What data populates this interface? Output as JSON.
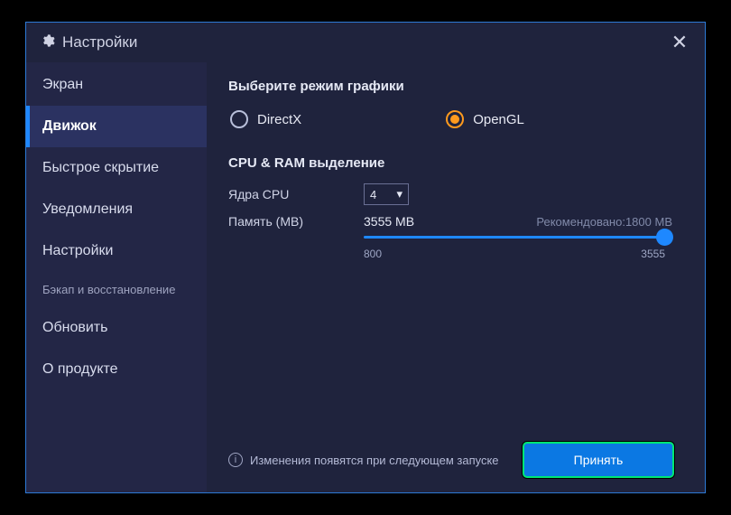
{
  "title": "Настройки",
  "sidebar": {
    "items": [
      {
        "label": "Экран"
      },
      {
        "label": "Движок"
      },
      {
        "label": "Быстрое скрытие"
      },
      {
        "label": "Уведомления"
      },
      {
        "label": "Настройки"
      },
      {
        "label": "Бэкап и восстановление"
      },
      {
        "label": "Обновить"
      },
      {
        "label": "О продукте"
      }
    ],
    "active_index": 1
  },
  "graphics": {
    "heading": "Выберите режим графики",
    "options": {
      "directx": "DirectX",
      "opengl": "OpenGL"
    },
    "selected": "opengl"
  },
  "resources": {
    "heading": "CPU & RAM выделение",
    "cpu_label": "Ядра CPU",
    "cpu_value": "4",
    "mem_label": "Память (MB)",
    "mem_value": "3555 MB",
    "recommended_label": "Рекомендовано:1800 MB",
    "slider": {
      "min": "800",
      "max": "3555",
      "value": 3555
    }
  },
  "footer": {
    "notice": "Изменения появятся при следующем запуске",
    "accept": "Принять"
  }
}
